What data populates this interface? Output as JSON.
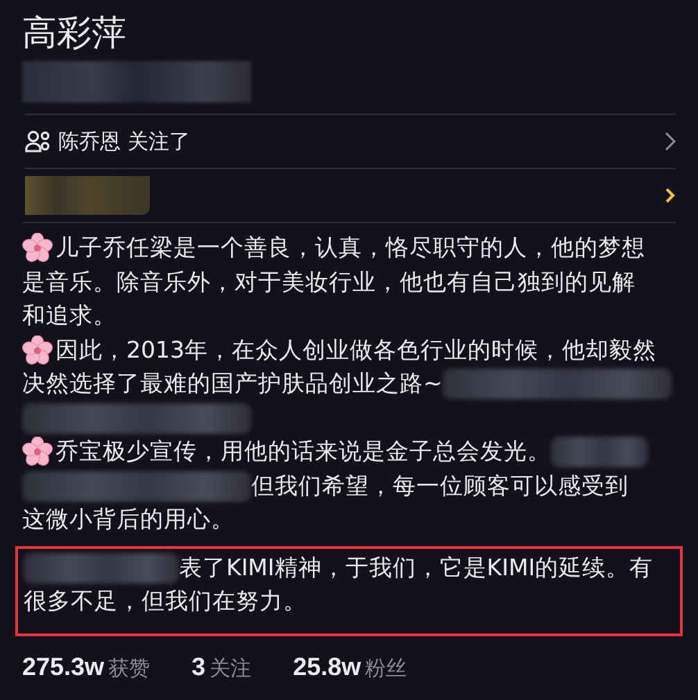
{
  "profile": {
    "name": "高彩萍",
    "subtitle_redacted": true
  },
  "follow_row": {
    "text": "陈乔恩 关注了"
  },
  "link_row": {
    "redacted": true
  },
  "bio": [
    {
      "highlighted": false,
      "lines": [
        [
          {
            "kind": "flower"
          },
          {
            "kind": "text",
            "text": "儿子乔任梁是一个善良，认真，恪尽职守的人，他的梦想"
          }
        ],
        [
          {
            "kind": "text",
            "text": "是音乐。除音乐外，对于美妆行业，他也有自己独到的见解"
          }
        ],
        [
          {
            "kind": "text",
            "text": "和追求。"
          }
        ]
      ]
    },
    {
      "highlighted": false,
      "lines": [
        [
          {
            "kind": "flower"
          },
          {
            "kind": "text",
            "text": "因此，2013年，在众人创业做各色行业的时候，他却毅然"
          }
        ],
        [
          {
            "kind": "text",
            "text": "决然选择了最难的国产护肤品创业之路~"
          },
          {
            "kind": "redaction"
          }
        ],
        [
          {
            "kind": "redaction"
          }
        ]
      ]
    },
    {
      "highlighted": false,
      "lines": [
        [
          {
            "kind": "flower"
          },
          {
            "kind": "text",
            "text": "乔宝极少宣传，用他的话来说是金子总会发光。"
          },
          {
            "kind": "redaction_short"
          }
        ],
        [
          {
            "kind": "redaction"
          },
          {
            "kind": "text",
            "text": "但我们希望，每一位顾客可以感受到"
          }
        ],
        [
          {
            "kind": "text",
            "text": "这微小背后的用心。"
          }
        ]
      ]
    },
    {
      "highlighted": true,
      "lines": [
        [
          {
            "kind": "redaction_wide"
          },
          {
            "kind": "text",
            "text": "表了KIMI精神，于我们，它是KIMI的延续。有"
          }
        ],
        [
          {
            "kind": "text",
            "text": "很多不足，但我们在努力。"
          }
        ]
      ]
    }
  ],
  "stats": [
    {
      "value": "275.3w",
      "label": "获赞"
    },
    {
      "value": "3",
      "label": "关注"
    },
    {
      "value": "25.8w",
      "label": "粉丝"
    }
  ]
}
